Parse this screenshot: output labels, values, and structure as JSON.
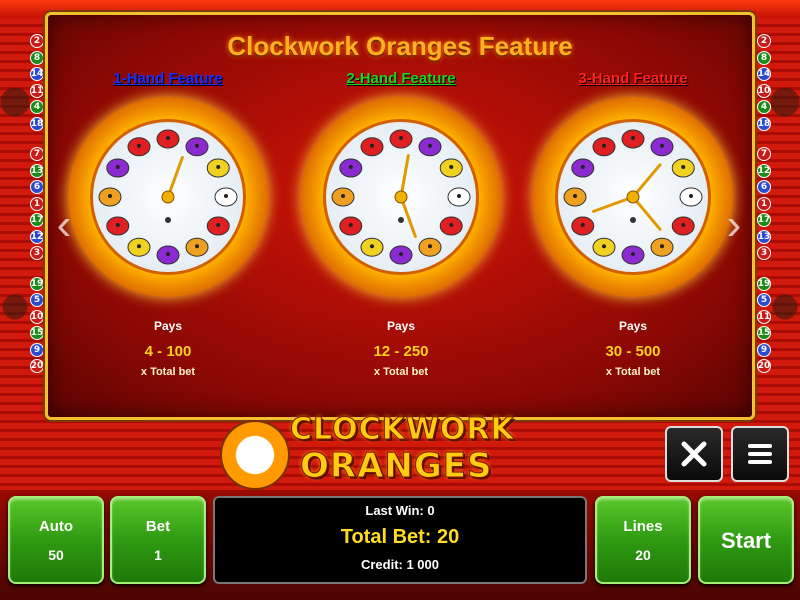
{
  "panel": {
    "title": "Clockwork Oranges Feature"
  },
  "features": [
    {
      "label": "1-Hand Feature",
      "color": "#1a2cff",
      "pays_label": "Pays",
      "pays_range": "4 - 100",
      "pays_sub": "x Total bet",
      "hands": 1
    },
    {
      "label": "2-Hand Feature",
      "color": "#1fd21f",
      "pays_label": "Pays",
      "pays_range": "12 - 250",
      "pays_sub": "x Total bet",
      "hands": 2
    },
    {
      "label": "3-Hand Feature",
      "color": "#ff2020",
      "pays_label": "Pays",
      "pays_range": "30 - 500",
      "pays_sub": "x Total bet",
      "hands": 3
    }
  ],
  "lines_left": [
    "2",
    "8",
    "14",
    "11",
    "4",
    "18",
    "7",
    "13",
    "6",
    "1",
    "17",
    "12",
    "3",
    "19",
    "5",
    "10",
    "15",
    "9",
    "20"
  ],
  "lines_right": [
    "2",
    "8",
    "14",
    "10",
    "4",
    "18",
    "7",
    "12",
    "6",
    "1",
    "17",
    "13",
    "3",
    "19",
    "5",
    "11",
    "15",
    "9",
    "20"
  ],
  "logo": {
    "line1": "CLOCKWORK",
    "line2": "ORANGES"
  },
  "controls": {
    "auto_label": "Auto",
    "auto_value": "50",
    "bet_label": "Bet",
    "bet_value": "1",
    "lines_label": "Lines",
    "lines_value": "20",
    "start_label": "Start",
    "last_win": "Last Win: 0",
    "total_bet": "Total Bet: 20",
    "credit": "Credit: 1 000"
  },
  "colors": {
    "accent_gold": "#ffb020",
    "button_green": "#2f9a12",
    "badge_colors": [
      "#c81a1a",
      "#1a8a1a",
      "#2a4ad0",
      "#c81a1a",
      "#1a8a1a",
      "#2a4ad0",
      "#c81a1a",
      "#1a8a1a",
      "#2a4ad0",
      "#c81a1a",
      "#1a8a1a",
      "#2a4ad0",
      "#c81a1a",
      "#1a8a1a",
      "#2a4ad0",
      "#c81a1a",
      "#1a8a1a",
      "#2a4ad0",
      "#c81a1a"
    ]
  },
  "icons": {
    "close": "close-icon",
    "menu": "menu-icon"
  }
}
